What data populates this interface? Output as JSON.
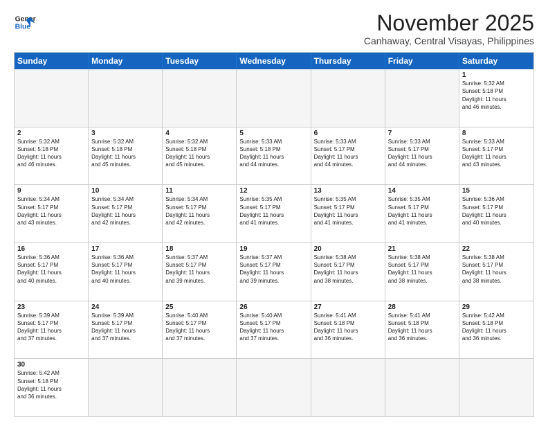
{
  "logo": {
    "line1": "General",
    "line2": "Blue"
  },
  "title": "November 2025",
  "location": "Canhaway, Central Visayas, Philippines",
  "header_days": [
    "Sunday",
    "Monday",
    "Tuesday",
    "Wednesday",
    "Thursday",
    "Friday",
    "Saturday"
  ],
  "weeks": [
    [
      {
        "day": "",
        "empty": true,
        "text": ""
      },
      {
        "day": "",
        "empty": true,
        "text": ""
      },
      {
        "day": "",
        "empty": true,
        "text": ""
      },
      {
        "day": "",
        "empty": true,
        "text": ""
      },
      {
        "day": "",
        "empty": true,
        "text": ""
      },
      {
        "day": "",
        "empty": true,
        "text": ""
      },
      {
        "day": "1",
        "empty": false,
        "text": "Sunrise: 5:32 AM\nSunset: 5:18 PM\nDaylight: 11 hours\nand 46 minutes."
      }
    ],
    [
      {
        "day": "2",
        "empty": false,
        "text": "Sunrise: 5:32 AM\nSunset: 5:18 PM\nDaylight: 11 hours\nand 46 minutes."
      },
      {
        "day": "3",
        "empty": false,
        "text": "Sunrise: 5:32 AM\nSunset: 5:18 PM\nDaylight: 11 hours\nand 45 minutes."
      },
      {
        "day": "4",
        "empty": false,
        "text": "Sunrise: 5:32 AM\nSunset: 5:18 PM\nDaylight: 11 hours\nand 45 minutes."
      },
      {
        "day": "5",
        "empty": false,
        "text": "Sunrise: 5:33 AM\nSunset: 5:18 PM\nDaylight: 11 hours\nand 44 minutes."
      },
      {
        "day": "6",
        "empty": false,
        "text": "Sunrise: 5:33 AM\nSunset: 5:17 PM\nDaylight: 11 hours\nand 44 minutes."
      },
      {
        "day": "7",
        "empty": false,
        "text": "Sunrise: 5:33 AM\nSunset: 5:17 PM\nDaylight: 11 hours\nand 44 minutes."
      },
      {
        "day": "8",
        "empty": false,
        "text": "Sunrise: 5:33 AM\nSunset: 5:17 PM\nDaylight: 11 hours\nand 43 minutes."
      }
    ],
    [
      {
        "day": "9",
        "empty": false,
        "text": "Sunrise: 5:34 AM\nSunset: 5:17 PM\nDaylight: 11 hours\nand 43 minutes."
      },
      {
        "day": "10",
        "empty": false,
        "text": "Sunrise: 5:34 AM\nSunset: 5:17 PM\nDaylight: 11 hours\nand 42 minutes."
      },
      {
        "day": "11",
        "empty": false,
        "text": "Sunrise: 5:34 AM\nSunset: 5:17 PM\nDaylight: 11 hours\nand 42 minutes."
      },
      {
        "day": "12",
        "empty": false,
        "text": "Sunrise: 5:35 AM\nSunset: 5:17 PM\nDaylight: 11 hours\nand 41 minutes."
      },
      {
        "day": "13",
        "empty": false,
        "text": "Sunrise: 5:35 AM\nSunset: 5:17 PM\nDaylight: 11 hours\nand 41 minutes."
      },
      {
        "day": "14",
        "empty": false,
        "text": "Sunrise: 5:35 AM\nSunset: 5:17 PM\nDaylight: 11 hours\nand 41 minutes."
      },
      {
        "day": "15",
        "empty": false,
        "text": "Sunrise: 5:36 AM\nSunset: 5:17 PM\nDaylight: 11 hours\nand 40 minutes."
      }
    ],
    [
      {
        "day": "16",
        "empty": false,
        "text": "Sunrise: 5:36 AM\nSunset: 5:17 PM\nDaylight: 11 hours\nand 40 minutes."
      },
      {
        "day": "17",
        "empty": false,
        "text": "Sunrise: 5:36 AM\nSunset: 5:17 PM\nDaylight: 11 hours\nand 40 minutes."
      },
      {
        "day": "18",
        "empty": false,
        "text": "Sunrise: 5:37 AM\nSunset: 5:17 PM\nDaylight: 11 hours\nand 39 minutes."
      },
      {
        "day": "19",
        "empty": false,
        "text": "Sunrise: 5:37 AM\nSunset: 5:17 PM\nDaylight: 11 hours\nand 39 minutes."
      },
      {
        "day": "20",
        "empty": false,
        "text": "Sunrise: 5:38 AM\nSunset: 5:17 PM\nDaylight: 11 hours\nand 38 minutes."
      },
      {
        "day": "21",
        "empty": false,
        "text": "Sunrise: 5:38 AM\nSunset: 5:17 PM\nDaylight: 11 hours\nand 38 minutes."
      },
      {
        "day": "22",
        "empty": false,
        "text": "Sunrise: 5:38 AM\nSunset: 5:17 PM\nDaylight: 11 hours\nand 38 minutes."
      }
    ],
    [
      {
        "day": "23",
        "empty": false,
        "text": "Sunrise: 5:39 AM\nSunset: 5:17 PM\nDaylight: 11 hours\nand 37 minutes."
      },
      {
        "day": "24",
        "empty": false,
        "text": "Sunrise: 5:39 AM\nSunset: 5:17 PM\nDaylight: 11 hours\nand 37 minutes."
      },
      {
        "day": "25",
        "empty": false,
        "text": "Sunrise: 5:40 AM\nSunset: 5:17 PM\nDaylight: 11 hours\nand 37 minutes."
      },
      {
        "day": "26",
        "empty": false,
        "text": "Sunrise: 5:40 AM\nSunset: 5:17 PM\nDaylight: 11 hours\nand 37 minutes."
      },
      {
        "day": "27",
        "empty": false,
        "text": "Sunrise: 5:41 AM\nSunset: 5:18 PM\nDaylight: 11 hours\nand 36 minutes."
      },
      {
        "day": "28",
        "empty": false,
        "text": "Sunrise: 5:41 AM\nSunset: 5:18 PM\nDaylight: 11 hours\nand 36 minutes."
      },
      {
        "day": "29",
        "empty": false,
        "text": "Sunrise: 5:42 AM\nSunset: 5:18 PM\nDaylight: 11 hours\nand 36 minutes."
      }
    ],
    [
      {
        "day": "30",
        "empty": false,
        "text": "Sunrise: 5:42 AM\nSunset: 5:18 PM\nDaylight: 11 hours\nand 36 minutes."
      },
      {
        "day": "",
        "empty": true,
        "text": ""
      },
      {
        "day": "",
        "empty": true,
        "text": ""
      },
      {
        "day": "",
        "empty": true,
        "text": ""
      },
      {
        "day": "",
        "empty": true,
        "text": ""
      },
      {
        "day": "",
        "empty": true,
        "text": ""
      },
      {
        "day": "",
        "empty": true,
        "text": ""
      }
    ]
  ]
}
